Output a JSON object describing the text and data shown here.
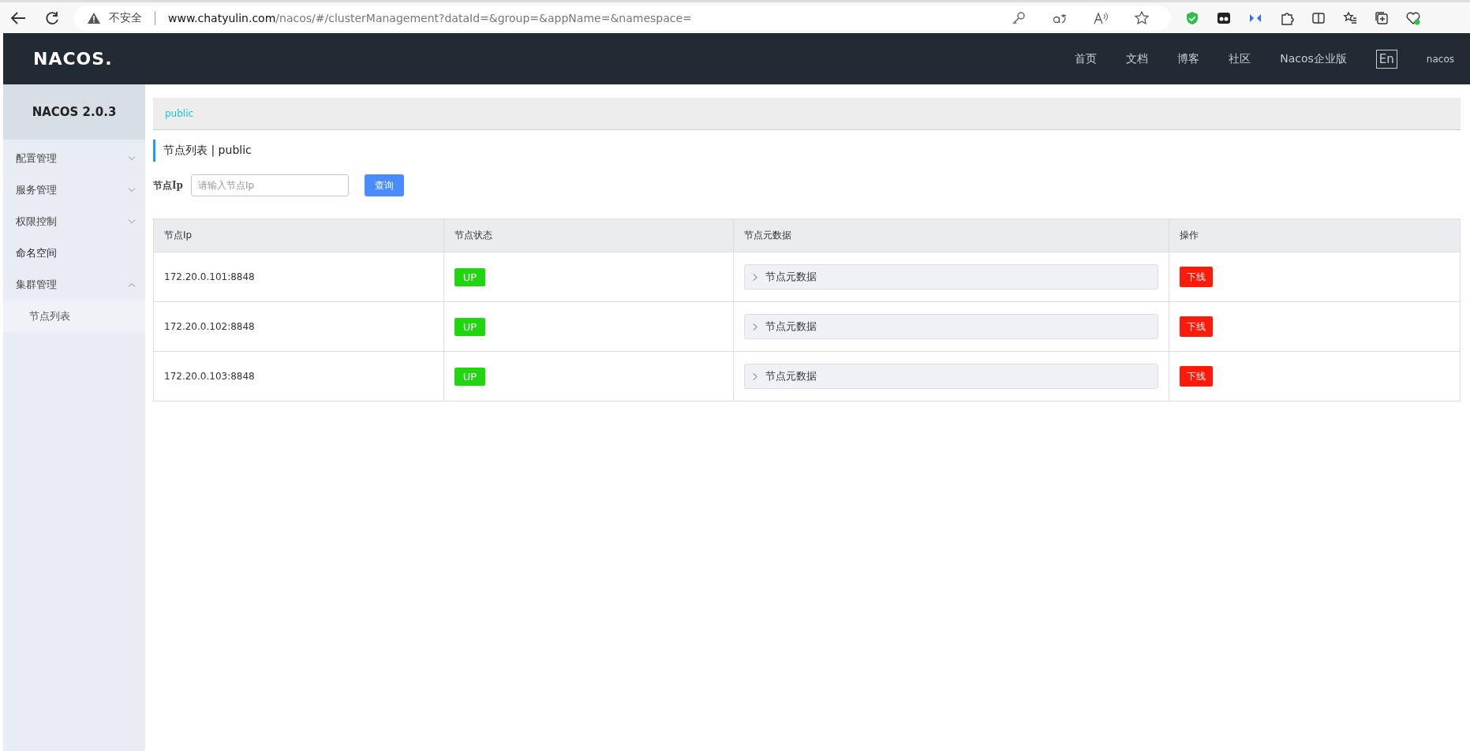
{
  "browser": {
    "security": "不安全",
    "url_host": "www.chatyulin.com",
    "url_path": "/nacos/#/clusterManagement?dataId=&group=&appName=&namespace="
  },
  "header": {
    "logo": "NACOS.",
    "nav": [
      {
        "kind": "link",
        "label": "首页"
      },
      {
        "kind": "link",
        "label": "文档"
      },
      {
        "kind": "link",
        "label": "博客"
      },
      {
        "kind": "link",
        "label": "社区"
      },
      {
        "kind": "link",
        "label": "Nacos企业版"
      },
      {
        "kind": "lang",
        "label": "En"
      },
      {
        "kind": "user",
        "label": "nacos"
      }
    ]
  },
  "sidebar": {
    "title": "NACOS 2.0.3",
    "items": [
      {
        "kind": "group",
        "label": "配置管理",
        "expanded": false
      },
      {
        "kind": "group",
        "label": "服务管理",
        "expanded": false
      },
      {
        "kind": "group",
        "label": "权限控制",
        "expanded": false
      },
      {
        "kind": "link",
        "label": "命名空间"
      },
      {
        "kind": "group",
        "label": "集群管理",
        "expanded": true,
        "children": [
          {
            "label": "节点列表"
          }
        ]
      }
    ]
  },
  "breadcrumb": "public",
  "page_title": {
    "title": "节点列表",
    "separator": "|",
    "namespace": "public"
  },
  "search": {
    "label": "节点Ip",
    "placeholder": "请输入节点Ip",
    "button": "查询"
  },
  "table": {
    "columns": [
      "节点Ip",
      "节点状态",
      "节点元数据",
      "操作"
    ],
    "rows": [
      {
        "ip": "172.20.0.101:8848",
        "status": "UP",
        "color": "#1fd60f",
        "metadata": "节点元数据",
        "expanded": false,
        "action": "下线"
      },
      {
        "ip": "172.20.0.102:8848",
        "status": "UP",
        "color": "#1fd60f",
        "metadata": "节点元数据",
        "expanded": false,
        "action": "下线"
      },
      {
        "ip": "172.20.0.103:8848",
        "status": "UP",
        "color": "#1fd60f",
        "metadata": "节点元数据",
        "expanded": false,
        "action": "下线"
      }
    ]
  }
}
